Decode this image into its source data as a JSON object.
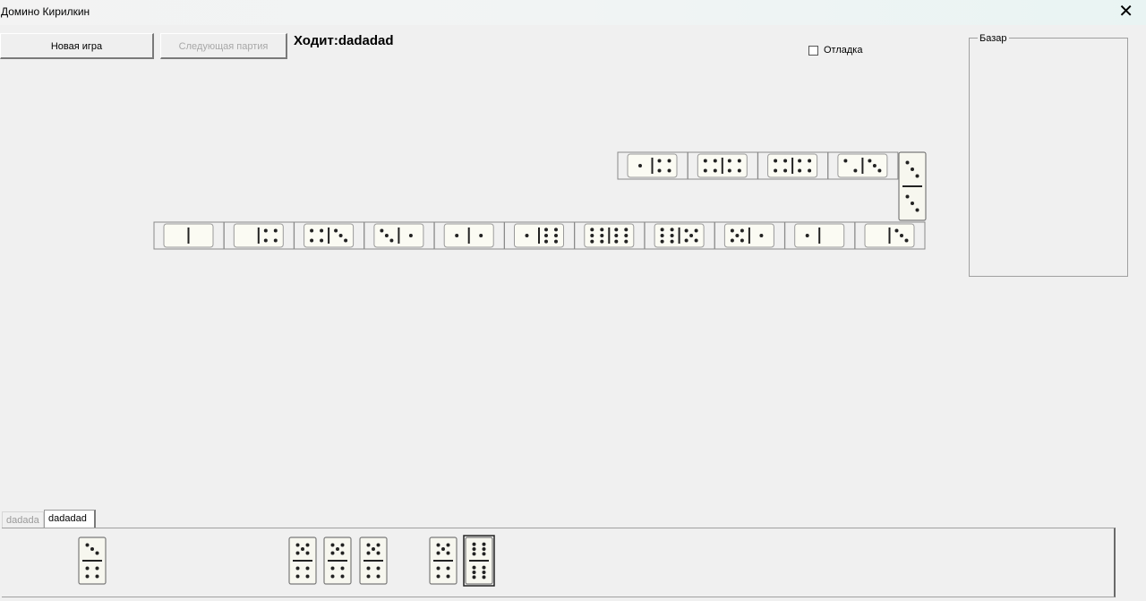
{
  "window": {
    "title": "Домино Кирилкин"
  },
  "toolbar": {
    "new_game_label": "Новая игра",
    "next_round_label": "Следующая партия",
    "turn_text": "Ходит:dadadad",
    "debug_label": "Отладка"
  },
  "bazar": {
    "label": "Базар"
  },
  "players": {
    "tabs": [
      {
        "label": "dadada",
        "active": false
      },
      {
        "label": "dadadad",
        "active": true
      }
    ]
  },
  "board": {
    "bottom_row": [
      [
        0,
        0
      ],
      [
        0,
        4
      ],
      [
        4,
        3
      ],
      [
        3,
        1
      ],
      [
        1,
        1
      ],
      [
        1,
        6
      ],
      [
        6,
        6
      ],
      [
        6,
        5
      ],
      [
        5,
        1
      ],
      [
        1,
        0
      ],
      [
        0,
        3
      ]
    ],
    "top_row": [
      [
        1,
        4
      ],
      [
        4,
        4
      ],
      [
        4,
        4
      ],
      [
        2,
        3
      ]
    ],
    "corner": [
      3,
      3
    ]
  },
  "hand": {
    "tiles": [
      [
        3,
        4
      ],
      [
        5,
        4
      ],
      [
        5,
        4
      ],
      [
        5,
        4
      ],
      [
        5,
        4
      ],
      [
        6,
        6
      ]
    ]
  }
}
